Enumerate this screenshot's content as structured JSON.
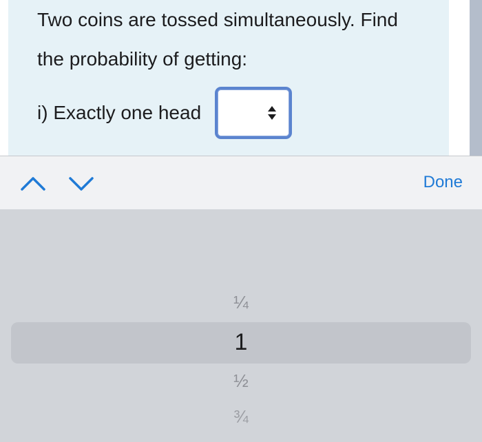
{
  "question": {
    "line1": "Two coins are tossed simultaneously. Find",
    "line2": "the probability of getting:",
    "part_label": "i) Exactly one head",
    "selected_value": ""
  },
  "accessory": {
    "done_label": "Done"
  },
  "picker": {
    "options": [
      "¼",
      "1",
      "½",
      "¾"
    ],
    "selected_index": 1
  },
  "colors": {
    "accent": "#1f7ad6",
    "select_border": "#5b84cf",
    "card_bg": "#e6f2f7"
  }
}
